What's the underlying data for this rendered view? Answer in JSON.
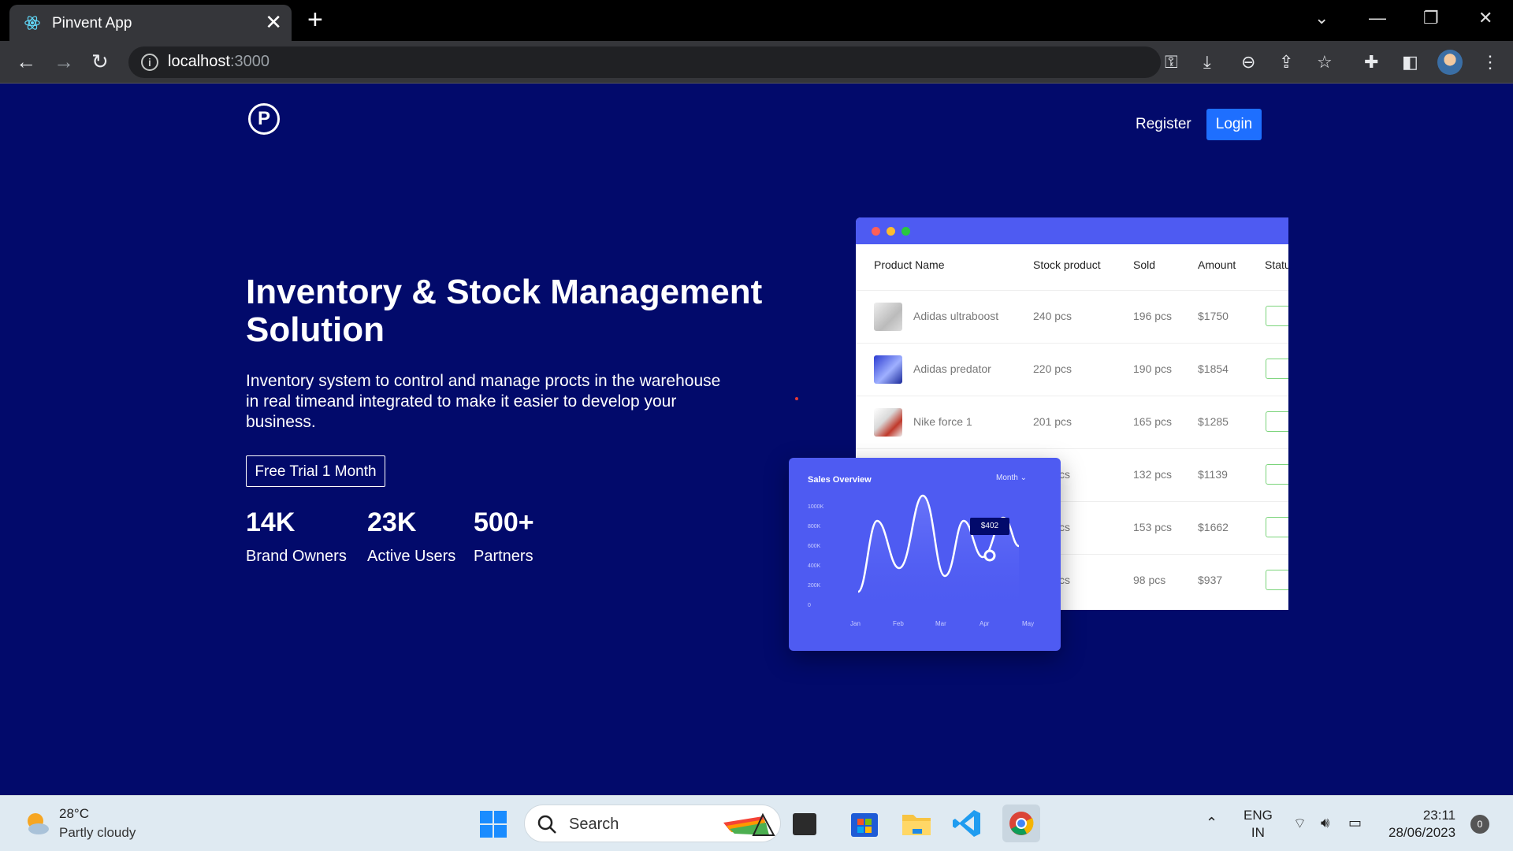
{
  "browser": {
    "tab_title": "Pinvent App",
    "tab_close": "✕",
    "new_tab": "+",
    "url_host": "localhost",
    "url_port": ":3000"
  },
  "page": {
    "logo_letter": "P",
    "nav": {
      "register": "Register",
      "login": "Login"
    },
    "hero": {
      "title": "Inventory & Stock Management Solution",
      "text": "Inventory system to control and manage procts in the warehouse in real timeand integrated to make it easier to develop your business.",
      "cta": "Free Trial 1 Month"
    },
    "stats": [
      {
        "value": "14K",
        "label": "Brand Owners"
      },
      {
        "value": "23K",
        "label": "Active Users"
      },
      {
        "value": "500+",
        "label": "Partners"
      }
    ],
    "illustration": {
      "columns": [
        "Product Name",
        "Stock product",
        "Sold",
        "Amount",
        "Statu"
      ],
      "rows": [
        {
          "name": "Adidas ultraboost",
          "stock": "240 pcs",
          "sold": "196 pcs",
          "amount": "$1750"
        },
        {
          "name": "Adidas predator",
          "stock": "220 pcs",
          "sold": "190 pcs",
          "amount": "$1854"
        },
        {
          "name": "Nike force 1",
          "stock": "201 pcs",
          "sold": "165 pcs",
          "amount": "$1285"
        },
        {
          "name": "",
          "stock": "cs",
          "sold": "132 pcs",
          "amount": "$1139"
        },
        {
          "name": "",
          "stock": "cs",
          "sold": "153 pcs",
          "amount": "$1662"
        },
        {
          "name": "",
          "stock": "cs",
          "sold": "98 pcs",
          "amount": "$937"
        }
      ],
      "sales": {
        "title": "Sales Overview",
        "period": "Month",
        "tooltip": "$402",
        "y_ticks": [
          "1000K",
          "800K",
          "600K",
          "400K",
          "200K",
          "0"
        ],
        "x_ticks": [
          "Jan",
          "Feb",
          "Mar",
          "Apr",
          "May"
        ]
      }
    }
  },
  "taskbar": {
    "weather_temp": "28°C",
    "weather_desc": "Partly cloudy",
    "search_label": "Search",
    "lang_line1": "ENG",
    "lang_line2": "IN",
    "time": "23:11",
    "date": "28/06/2023",
    "notifications": "0"
  },
  "colors": {
    "page_bg": "#020a6b",
    "accent": "#1e6fff",
    "card_accent": "#4e5bf2"
  }
}
